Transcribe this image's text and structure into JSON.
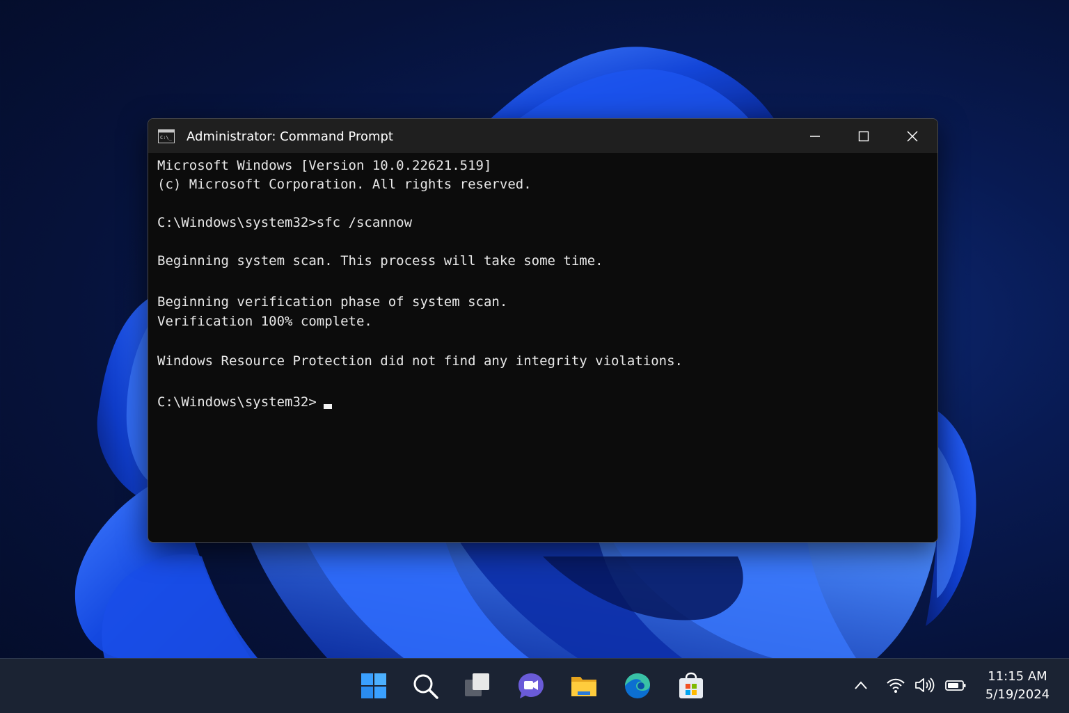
{
  "window": {
    "title": "Administrator: Command Prompt",
    "app_icon": "command-prompt-icon",
    "controls": [
      "minimize-icon",
      "maximize-icon",
      "close-icon"
    ]
  },
  "console": {
    "lines": [
      "Microsoft Windows [Version 10.0.22621.519]",
      "(c) Microsoft Corporation. All rights reserved.",
      "C:\\Windows\\system32>sfc /scannow",
      "Beginning system scan. This process will take some time.",
      "Beginning verification phase of system scan.",
      "Verification 100% complete.",
      "Windows Resource Protection did not find any integrity violations.",
      "C:\\Windows\\system32>"
    ]
  },
  "taskbar": {
    "apps": [
      "windows-start-icon",
      "search-icon",
      "task-view-icon",
      "teams-chat-icon",
      "file-explorer-icon",
      "edge-browser-icon",
      "microsoft-store-icon"
    ],
    "tray": [
      "chevron-up-icon",
      "wifi-icon",
      "volume-icon",
      "battery-icon"
    ],
    "time": "11:15 AM",
    "date": "5/19/2024"
  },
  "colors": {
    "console_bg": "#0c0c0c",
    "console_text": "#e8e8e8",
    "titlebar_bg": "#1f1f1f",
    "wallpaper_accent": "#1f5cff",
    "taskbar_bg": "#1b2333"
  }
}
